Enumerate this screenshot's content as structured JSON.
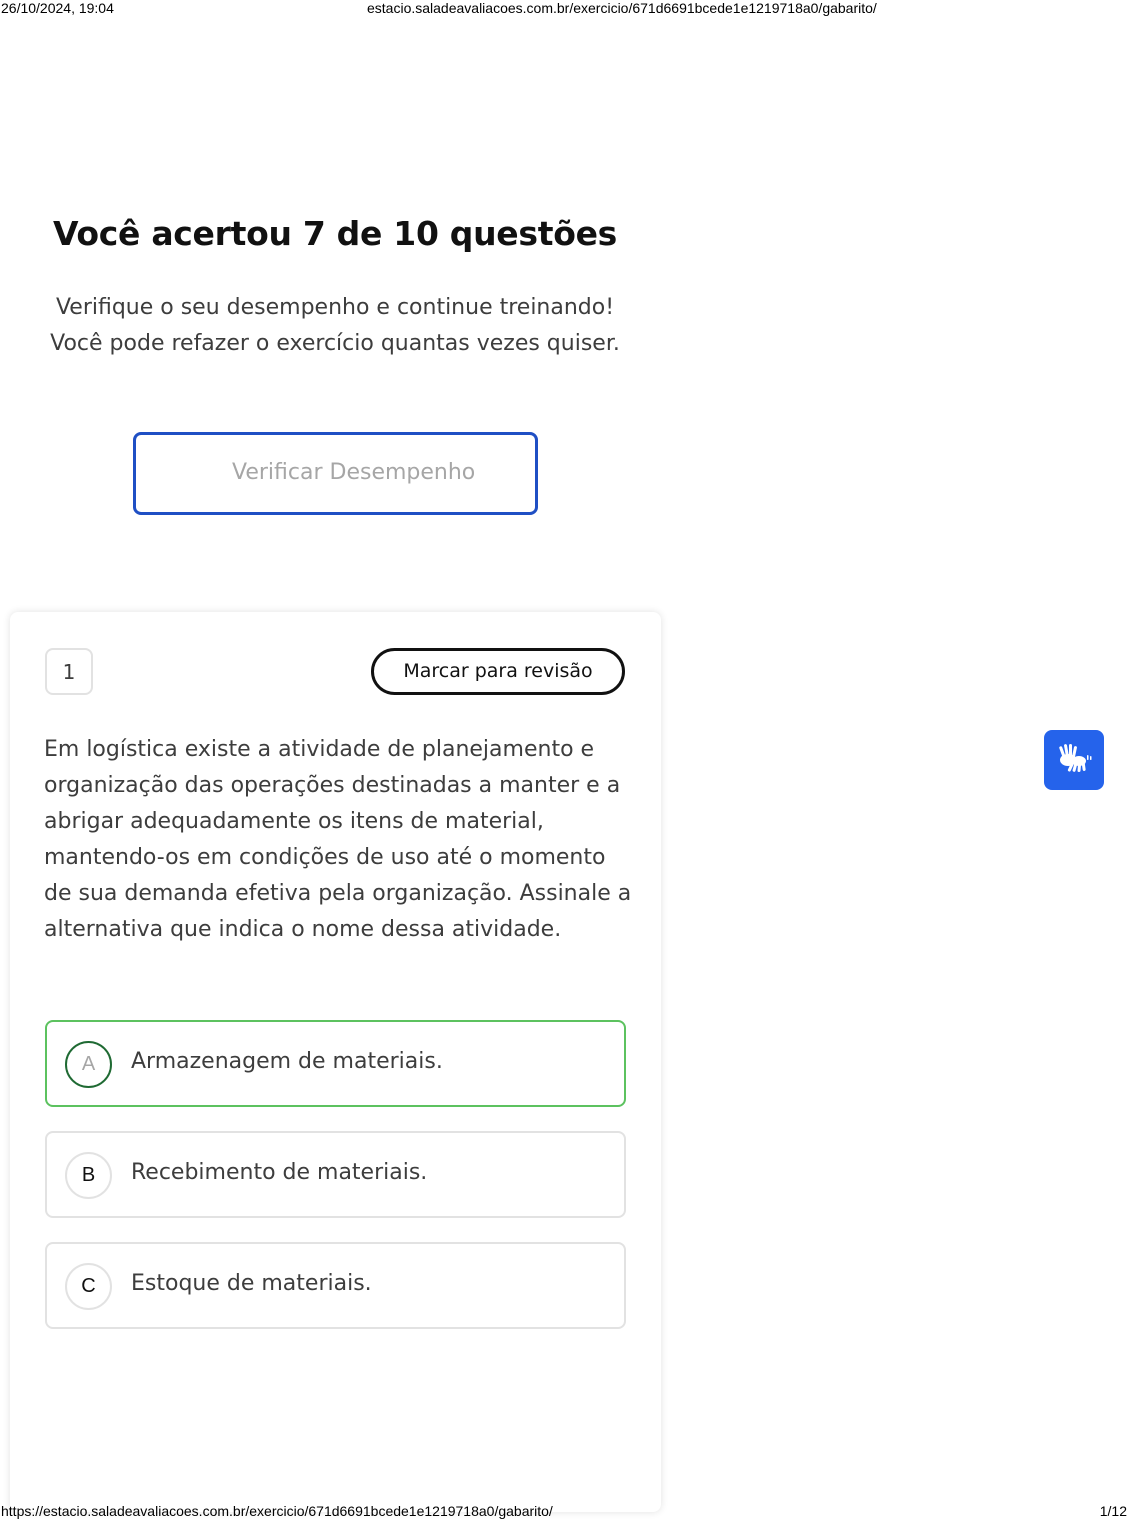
{
  "print": {
    "datetime": "26/10/2024, 19:04",
    "header_url": "estacio.saladeavaliacoes.com.br/exercicio/671d6691bcede1e1219718a0/gabarito/",
    "footer_url": "https://estacio.saladeavaliacoes.com.br/exercicio/671d6691bcede1e1219718a0/gabarito/",
    "page_indicator": "1/12"
  },
  "result": {
    "title": "Você acertou 7 de 10 questões",
    "subtitle": "Verifique o seu desempenho e continue treinando! Você pode refazer o exercício quantas vezes quiser.",
    "verify_button_label": "Verificar Desempenho"
  },
  "question": {
    "number": "1",
    "review_button_label": "Marcar para revisão",
    "text": "Em logística existe a atividade de planejamento e organização das operações destinadas a manter e a abrigar adequadamente os itens de material, mantendo-os em condições de uso até o momento de sua demanda efetiva pela organização. Assinale a alternativa que indica o nome dessa atividade.",
    "options": [
      {
        "letter": "A",
        "text": "Armazenagem de materiais.",
        "status": "correct"
      },
      {
        "letter": "B",
        "text": "Recebimento de materiais."
      },
      {
        "letter": "C",
        "text": "Estoque de materiais."
      }
    ]
  },
  "accessibility_widget": {
    "icon": "sign-language-hands-icon"
  },
  "colors": {
    "primary_blue": "#1f4fc4",
    "widget_blue": "#2563eb",
    "correct_green": "#5cc25f",
    "correct_letter_ring": "#1f6a33",
    "muted_text": "#a6a6a6",
    "body_text": "#3d3d3d"
  }
}
